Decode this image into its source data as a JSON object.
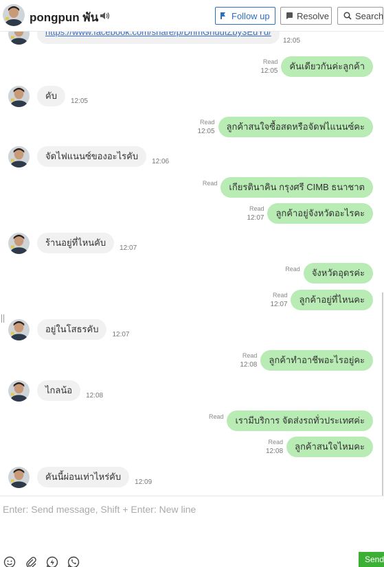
{
  "header": {
    "name": "pongpun พัน",
    "follow_up": "Follow up",
    "resolve": "Resolve",
    "search": "Search"
  },
  "partial": {
    "link": "https://www.facebook.com/share/p/DhmGhuutZby3EuYd/",
    "time": "12:05"
  },
  "messages": [
    {
      "dir": "out",
      "text": "คันเดียวกันค่ะลูกค้า",
      "read": "Read",
      "time": "12:05"
    },
    {
      "dir": "in",
      "text": "คับ",
      "time": "12:05"
    },
    {
      "dir": "out",
      "text": "ลูกค้าสนใจซื้อสดหรือจัดฟไแนนซ์คะ",
      "read": "Read",
      "time": "12:05"
    },
    {
      "dir": "in",
      "text": "จัดไฟแนนซ์ของอะไรคับ",
      "time": "12:06"
    },
    {
      "dir": "out",
      "text": "เกียรตินาคิน กรุงศรี CIMB ธนาชาต",
      "read": "Read",
      "time": ""
    },
    {
      "dir": "out",
      "text": "ลูกค้าอยู่จังหวัดอะไรคะ",
      "read": "Read",
      "time": "12:07"
    },
    {
      "dir": "in",
      "text": "ร้านอยู่ที่ไหนคับ",
      "time": "12:07"
    },
    {
      "dir": "out",
      "text": "จังหวัดอุดรค่ะ",
      "read": "Read",
      "time": ""
    },
    {
      "dir": "out",
      "text": "ลูกค้าอยู่ที่ไหนคะ",
      "read": "Read",
      "time": "12:07"
    },
    {
      "dir": "in",
      "text": "อยู่ในโสธรคับ",
      "time": "12:07"
    },
    {
      "dir": "out",
      "text": "ลูกค้าทำอาชีพอะไรอยู่คะ",
      "read": "Read",
      "time": "12:08"
    },
    {
      "dir": "in",
      "text": "ไกลน้อ",
      "time": "12:08"
    },
    {
      "dir": "out",
      "text": "เรามีบริการ จัดส่งรถทั่วประเทศค่ะ",
      "read": "Read",
      "time": ""
    },
    {
      "dir": "out",
      "text": "ลูกค้าสนใจไหมคะ",
      "read": "Read",
      "time": "12:08"
    },
    {
      "dir": "in",
      "text": "คันนี้ผ่อนเท่าไหร่คับ",
      "time": "12:09"
    }
  ],
  "composer": {
    "placeholder": "Enter: Send message, Shift + Enter: New line",
    "send": "Send"
  },
  "icons": [
    "speaker-icon",
    "follow-up-icon",
    "resolve-icon",
    "search-icon",
    "emoji-icon",
    "attachment-icon",
    "quick-reply-icon",
    "whatsapp-icon"
  ],
  "colors": {
    "outgoing_bubble": "#b8ecb4",
    "incoming_bubble": "#f1f1f1",
    "send_button": "#3cb034",
    "follow_up": "#2c6fbf"
  }
}
